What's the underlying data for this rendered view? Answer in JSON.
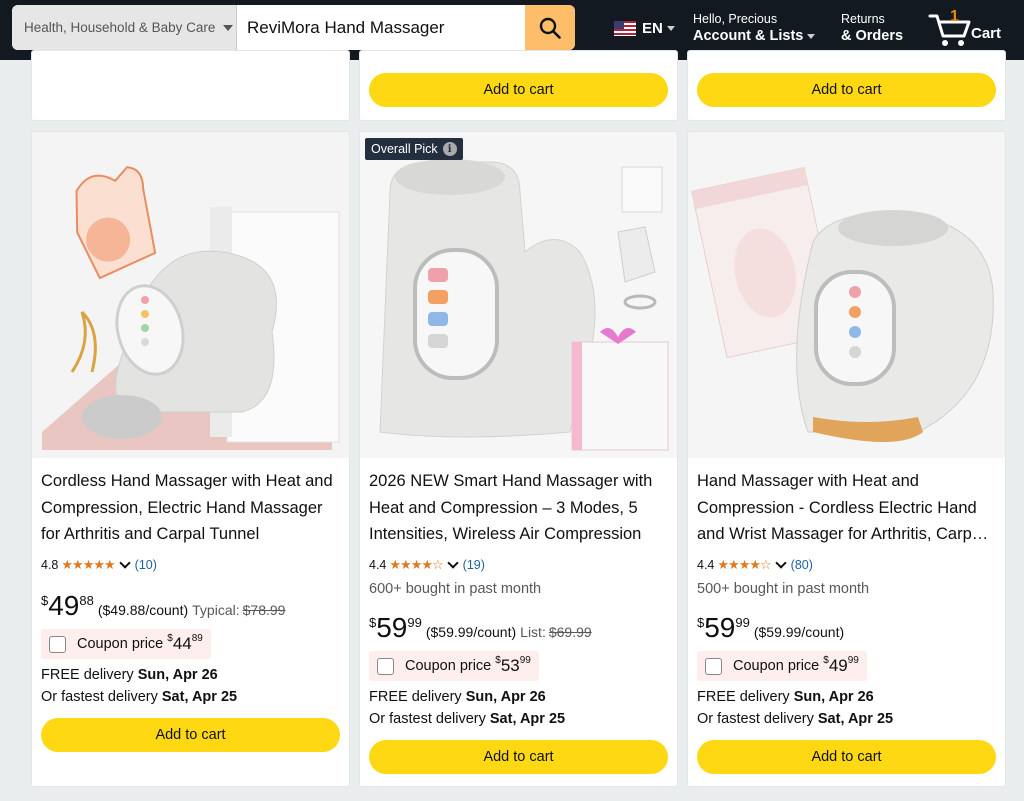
{
  "header": {
    "search_category": "Health, Household & Baby Care",
    "search_value": "ReviMora Hand Massager",
    "lang": "EN",
    "account_greeting": "Hello, Precious",
    "account_label": "Account & Lists",
    "returns_label": "Returns",
    "orders_label": "& Orders",
    "cart_count": "1",
    "cart_label": "Cart"
  },
  "top_row": {
    "add_to_cart_label": "Add to cart"
  },
  "products": [
    {
      "title": "Cordless Hand Massager with Heat and Compression, Electric Hand Massager for Arthritis and Carpal Tunnel",
      "rating": "4.8",
      "stars": "★★★★★",
      "review_count": "(10)",
      "price_symbol": "$",
      "price_whole": "49",
      "price_fraction": "88",
      "unit_price": "($49.88/count)",
      "compare_label": "Typical:",
      "compare_price": "$78.99",
      "coupon_label": "Coupon price",
      "coupon_symbol": "$",
      "coupon_whole": "44",
      "coupon_fraction": "89",
      "delivery_label": "FREE delivery",
      "delivery_date": "Sun, Apr 26",
      "fastest_label": "Or fastest delivery",
      "fastest_date": "Sat, Apr 25",
      "add_to_cart_label": "Add to cart"
    },
    {
      "badge": "Overall Pick",
      "title": "2026 NEW Smart Hand Massager with Heat and Compression – 3 Modes, 5 Intensities, Wireless Air Compression",
      "rating": "4.4",
      "stars": "★★★★☆",
      "review_count": "(19)",
      "bought": "600+ bought in past month",
      "price_symbol": "$",
      "price_whole": "59",
      "price_fraction": "99",
      "unit_price": "($59.99/count)",
      "compare_label": "List:",
      "compare_price": "$69.99",
      "coupon_label": "Coupon price",
      "coupon_symbol": "$",
      "coupon_whole": "53",
      "coupon_fraction": "99",
      "delivery_label": "FREE delivery",
      "delivery_date": "Sun, Apr 26",
      "fastest_label": "Or fastest delivery",
      "fastest_date": "Sat, Apr 25",
      "add_to_cart_label": "Add to cart"
    },
    {
      "title": "Hand Massager with Heat and Compression - Cordless Electric Hand and Wrist Massager for Arthritis, Carpal Tunnel",
      "rating": "4.4",
      "stars": "★★★★☆",
      "review_count": "(80)",
      "bought": "500+ bought in past month",
      "price_symbol": "$",
      "price_whole": "59",
      "price_fraction": "99",
      "unit_price": "($59.99/count)",
      "coupon_label": "Coupon price",
      "coupon_symbol": "$",
      "coupon_whole": "49",
      "coupon_fraction": "99",
      "delivery_label": "FREE delivery",
      "delivery_date": "Sun, Apr 26",
      "fastest_label": "Or fastest delivery",
      "fastest_date": "Sat, Apr 25",
      "add_to_cart_label": "Add to cart"
    }
  ]
}
